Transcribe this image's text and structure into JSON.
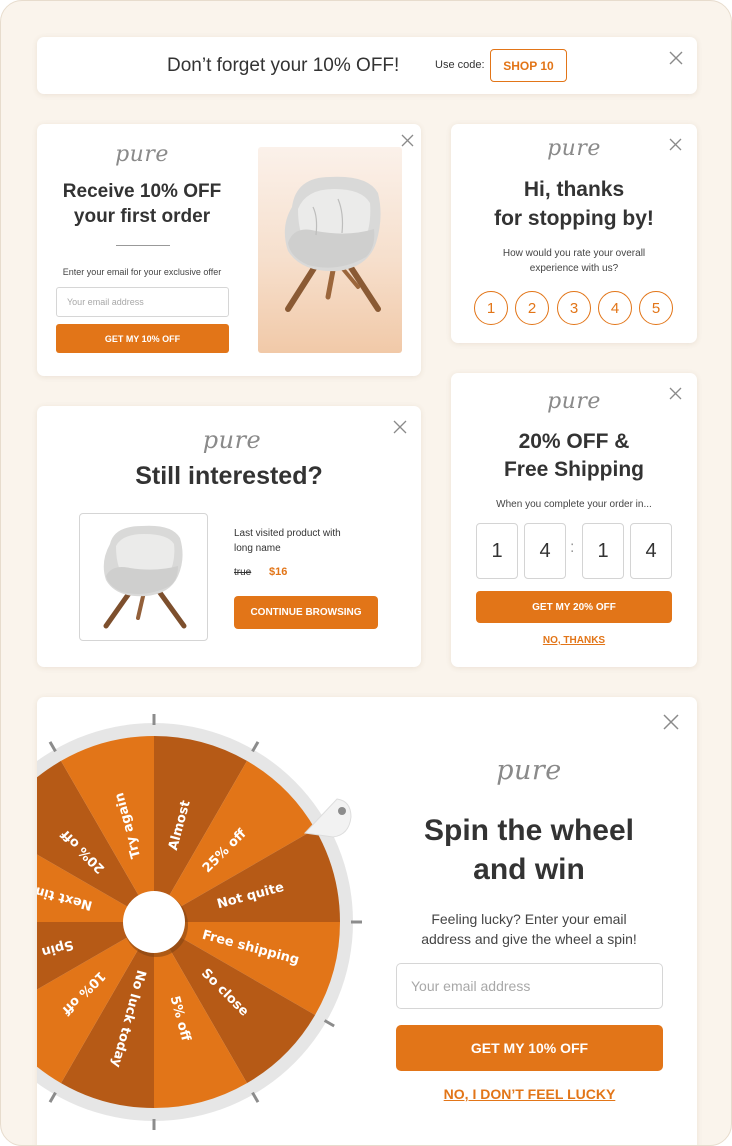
{
  "brand": {
    "logo_text": "pure",
    "accent": "#e27518"
  },
  "banner": {
    "headline": "Don’t forget your 10% OFF!",
    "code_label": "Use code:",
    "code": "SHOP 10"
  },
  "signup_popup": {
    "title_line1": "Receive 10% OFF",
    "title_line2": "your first order",
    "prompt": "Enter your email for your exclusive offer",
    "email_placeholder": "Your email address",
    "button": "GET MY 10% OFF",
    "image": "armchair-photo"
  },
  "rating_popup": {
    "title_line1": "Hi, thanks",
    "title_line2": "for stopping by!",
    "question_line1": "How would you rate your overall",
    "question_line2": "experience with us?",
    "options": [
      "1",
      "2",
      "3",
      "4",
      "5"
    ]
  },
  "reminder_popup": {
    "title": "Still interested?",
    "product_name_line1": "Last visited product with",
    "product_name_line2": "long name",
    "old_price": "true",
    "price": "$16",
    "button": "CONTINUE BROWSING",
    "image": "armchair-photo"
  },
  "countdown_popup": {
    "title_line1": "20% OFF &",
    "title_line2": "Free Shipping",
    "subtitle": "When you complete your order in...",
    "digits": [
      "1",
      "4",
      "1",
      "4"
    ],
    "separator": ":",
    "button": "GET MY 20% OFF",
    "decline": "NO, THANKS"
  },
  "wheel_popup": {
    "title_line1": "Spin the wheel",
    "title_line2": "and win",
    "body_line1": "Feeling lucky? Enter your email",
    "body_line2": "address and give the wheel a spin!",
    "email_placeholder": "Your email address",
    "button": "GET MY 10% OFF",
    "decline": "NO, I DON’T FEEL LUCKY",
    "wheel_segments": [
      "Almost",
      "25% off",
      "Not quite",
      "Free shipping",
      "So close",
      "5% off",
      "No luck today",
      "10% off",
      "Spin",
      "Next time",
      "20% off",
      "Try again"
    ],
    "segment_colors": [
      "#b65a16",
      "#e27518"
    ]
  }
}
